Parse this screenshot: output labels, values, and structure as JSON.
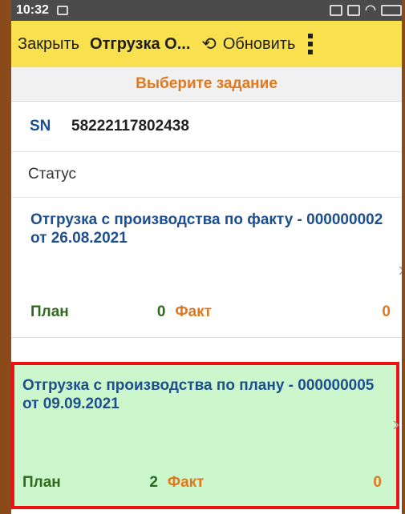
{
  "statusbar": {
    "time": "10:32"
  },
  "toolbar": {
    "close_label": "Закрыть",
    "title": "Отгрузка О...",
    "refresh_label": "Обновить"
  },
  "select_task_label": "Выберите задание",
  "sn": {
    "label": "SN",
    "value": "58222117802438"
  },
  "status_label": "Статус",
  "tasks": [
    {
      "title": "Отгрузка с производства по факту - 000000002 от 26.08.2021",
      "plan_label": "План",
      "plan_value": "0",
      "fact_label": "Факт",
      "fact_value": "0",
      "selected": false
    },
    {
      "title": "Отгрузка с производства по плану - 000000005 от 09.09.2021",
      "plan_label": "План",
      "plan_value": "2",
      "fact_label": "Факт",
      "fact_value": "0",
      "selected": true
    }
  ],
  "colors": {
    "toolbar_bg": "#f9e04f",
    "accent_orange": "#e2781e",
    "title_blue": "#1d4f8f",
    "plan_green": "#2f6a1e",
    "selected_bg": "#ccf7cc",
    "highlight_border": "#ee1111"
  }
}
